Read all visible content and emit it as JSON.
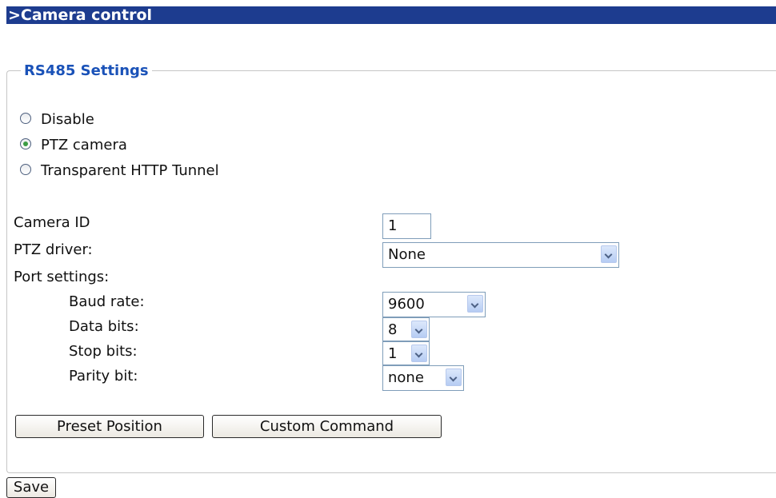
{
  "header": {
    "title": ">Camera control"
  },
  "rs485": {
    "legend": "RS485 Settings",
    "modes": [
      {
        "label": "Disable",
        "checked": false
      },
      {
        "label": "PTZ camera",
        "checked": true
      },
      {
        "label": "Transparent HTTP Tunnel",
        "checked": false
      }
    ],
    "camera_id": {
      "label": "Camera ID",
      "value": "1"
    },
    "ptz_driver": {
      "label": "PTZ driver:",
      "value": "None"
    },
    "port_settings": {
      "label": "Port settings:",
      "baud_rate": {
        "label": "Baud rate:",
        "value": "9600"
      },
      "data_bits": {
        "label": "Data bits:",
        "value": "8"
      },
      "stop_bits": {
        "label": "Stop bits:",
        "value": "1"
      },
      "parity_bit": {
        "label": "Parity bit:",
        "value": "none"
      }
    },
    "buttons": {
      "preset_position": "Preset Position",
      "custom_command": "Custom Command"
    }
  },
  "footer": {
    "save_label": "Save"
  }
}
